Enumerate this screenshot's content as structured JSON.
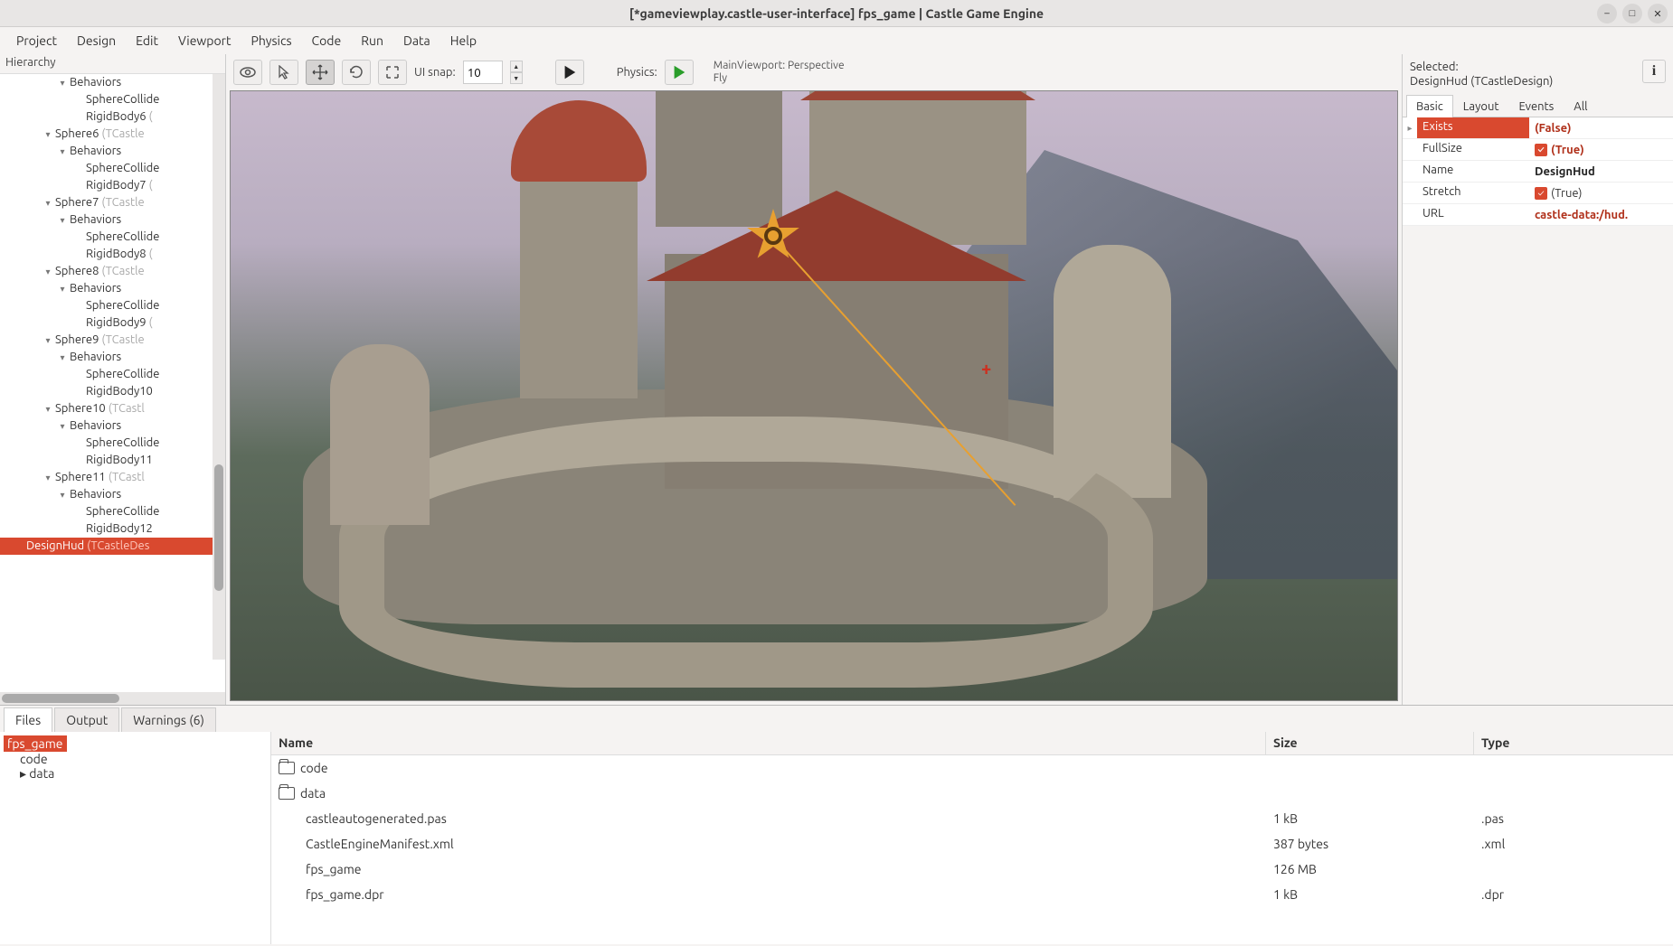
{
  "window": {
    "title": "[*gameviewplay.castle-user-interface] fps_game | Castle Game Engine"
  },
  "menu": [
    "Project",
    "Design",
    "Edit",
    "Viewport",
    "Physics",
    "Code",
    "Run",
    "Data",
    "Help"
  ],
  "hierarchy": {
    "label": "Hierarchy",
    "tree": [
      {
        "indent": 60,
        "arrow": "▾",
        "name": "Behaviors",
        "type": ""
      },
      {
        "indent": 78,
        "arrow": "",
        "name": "SphereCollide",
        "type": ""
      },
      {
        "indent": 78,
        "arrow": "",
        "name": "RigidBody6",
        "type": "("
      },
      {
        "indent": 44,
        "arrow": "▾",
        "name": "Sphere6",
        "type": "(TCastle"
      },
      {
        "indent": 60,
        "arrow": "▾",
        "name": "Behaviors",
        "type": ""
      },
      {
        "indent": 78,
        "arrow": "",
        "name": "SphereCollide",
        "type": ""
      },
      {
        "indent": 78,
        "arrow": "",
        "name": "RigidBody7",
        "type": "("
      },
      {
        "indent": 44,
        "arrow": "▾",
        "name": "Sphere7",
        "type": "(TCastle"
      },
      {
        "indent": 60,
        "arrow": "▾",
        "name": "Behaviors",
        "type": ""
      },
      {
        "indent": 78,
        "arrow": "",
        "name": "SphereCollide",
        "type": ""
      },
      {
        "indent": 78,
        "arrow": "",
        "name": "RigidBody8",
        "type": "("
      },
      {
        "indent": 44,
        "arrow": "▾",
        "name": "Sphere8",
        "type": "(TCastle"
      },
      {
        "indent": 60,
        "arrow": "▾",
        "name": "Behaviors",
        "type": ""
      },
      {
        "indent": 78,
        "arrow": "",
        "name": "SphereCollide",
        "type": ""
      },
      {
        "indent": 78,
        "arrow": "",
        "name": "RigidBody9",
        "type": "("
      },
      {
        "indent": 44,
        "arrow": "▾",
        "name": "Sphere9",
        "type": "(TCastle"
      },
      {
        "indent": 60,
        "arrow": "▾",
        "name": "Behaviors",
        "type": ""
      },
      {
        "indent": 78,
        "arrow": "",
        "name": "SphereCollide",
        "type": ""
      },
      {
        "indent": 78,
        "arrow": "",
        "name": "RigidBody10",
        "type": ""
      },
      {
        "indent": 44,
        "arrow": "▾",
        "name": "Sphere10",
        "type": "(TCastl"
      },
      {
        "indent": 60,
        "arrow": "▾",
        "name": "Behaviors",
        "type": ""
      },
      {
        "indent": 78,
        "arrow": "",
        "name": "SphereCollide",
        "type": ""
      },
      {
        "indent": 78,
        "arrow": "",
        "name": "RigidBody11",
        "type": ""
      },
      {
        "indent": 44,
        "arrow": "▾",
        "name": "Sphere11",
        "type": "(TCastl"
      },
      {
        "indent": 60,
        "arrow": "▾",
        "name": "Behaviors",
        "type": ""
      },
      {
        "indent": 78,
        "arrow": "",
        "name": "SphereCollide",
        "type": ""
      },
      {
        "indent": 78,
        "arrow": "",
        "name": "RigidBody12",
        "type": ""
      },
      {
        "indent": 12,
        "arrow": "",
        "name": "DesignHud",
        "type": "(TCastleDes",
        "selected": true
      }
    ]
  },
  "toolbar": {
    "uisnap_label": "UI snap:",
    "uisnap_value": "10",
    "physics_label": "Physics:",
    "viewport_line1": "MainViewport: Perspective",
    "viewport_line2": "Fly"
  },
  "inspector": {
    "selected_label": "Selected:",
    "selected_value": "DesignHud (TCastleDesign)",
    "tabs": [
      "Basic",
      "Layout",
      "Events",
      "All"
    ],
    "props": [
      {
        "arrow": "▸",
        "name": "Exists",
        "highlight": true,
        "checkbox": false,
        "value": "(False)",
        "bold": true
      },
      {
        "arrow": "",
        "name": "FullSize",
        "checkbox": true,
        "value": "(True)",
        "bold": true
      },
      {
        "arrow": "",
        "name": "Name",
        "checkbox": false,
        "value": "DesignHud",
        "plain": true
      },
      {
        "arrow": "",
        "name": "Stretch",
        "checkbox": true,
        "value": "(True)"
      },
      {
        "arrow": "",
        "name": "URL",
        "checkbox": false,
        "value": "castle-data:/hud.",
        "bold": true
      }
    ]
  },
  "bottom": {
    "tabs": [
      {
        "label": "Files",
        "active": true
      },
      {
        "label": "Output",
        "active": false
      },
      {
        "label": "Warnings (6)",
        "active": false
      }
    ],
    "tree": [
      {
        "indent": 0,
        "name": "fps_game",
        "selected": true
      },
      {
        "indent": 14,
        "name": "code"
      },
      {
        "indent": 14,
        "name": "data",
        "arrow": "▸"
      }
    ],
    "columns": {
      "name": "Name",
      "size": "Size",
      "type": "Type"
    },
    "files": [
      {
        "icon": "folder",
        "name": "code",
        "size": "",
        "type": ""
      },
      {
        "icon": "folder",
        "name": "data",
        "size": "",
        "type": ""
      },
      {
        "icon": "file",
        "name": "castleautogenerated.pas",
        "size": "1 kB",
        "type": ".pas"
      },
      {
        "icon": "file",
        "name": "CastleEngineManifest.xml",
        "size": "387 bytes",
        "type": ".xml"
      },
      {
        "icon": "file",
        "name": "fps_game",
        "size": "126 MB",
        "type": ""
      },
      {
        "icon": "file",
        "name": "fps_game.dpr",
        "size": "1 kB",
        "type": ".dpr"
      }
    ]
  }
}
